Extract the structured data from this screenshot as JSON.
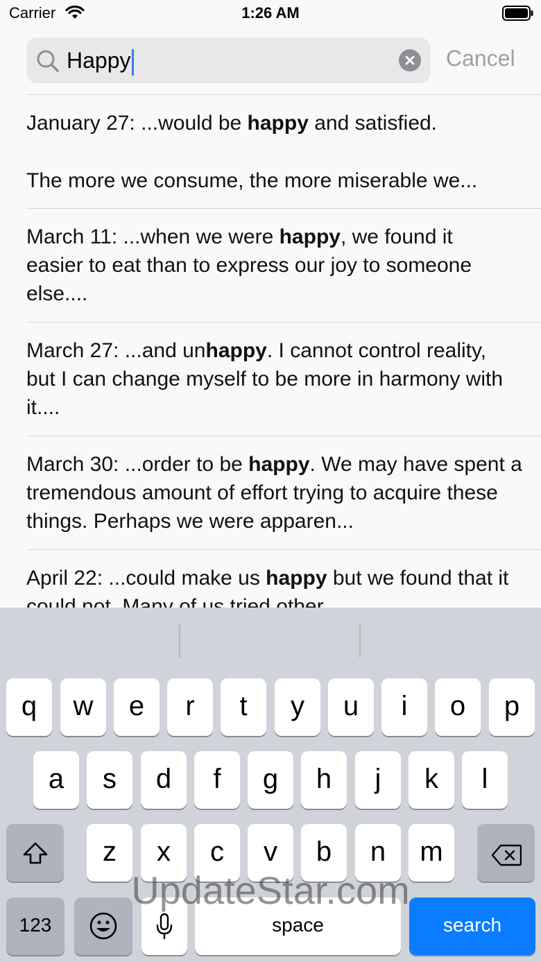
{
  "status_bar": {
    "carrier": "Carrier",
    "time": "1:26 AM"
  },
  "search": {
    "query": "Happy",
    "cancel_label": "Cancel"
  },
  "results": [
    {
      "date": "January 27:",
      "before": "  ...would be ",
      "match": "happy",
      "after": " and satisfied.",
      "line2": "The more we consume, the more miserable we..."
    },
    {
      "date": "March 11:",
      "before": "  ...when we were ",
      "match": "happy",
      "after": ", we found it easier to eat than to express our joy to someone else....",
      "line2": ""
    },
    {
      "date": "March 27:",
      "before": "  ...and un",
      "match": "happy",
      "after": ". I cannot control reality, but I can change myself to be more in harmony with it....",
      "line2": ""
    },
    {
      "date": "March 30:",
      "before": "  ...order to be ",
      "match": "happy",
      "after": ". We may have spent a tremendous amount of effort trying to acquire these things. Perhaps we were apparen...",
      "line2": ""
    },
    {
      "date": "April 22:",
      "before": "  ...could make us ",
      "match": "happy",
      "after": " but we found that it could not. Many of us tried other",
      "line2": ""
    }
  ],
  "keyboard": {
    "row1": [
      "q",
      "w",
      "e",
      "r",
      "t",
      "y",
      "u",
      "i",
      "o",
      "p"
    ],
    "row2": [
      "a",
      "s",
      "d",
      "f",
      "g",
      "h",
      "j",
      "k",
      "l"
    ],
    "row3": [
      "z",
      "x",
      "c",
      "v",
      "b",
      "n",
      "m"
    ],
    "numbers_label": "123",
    "space_label": "space",
    "search_label": "search"
  },
  "watermark": "UpdateStar.com"
}
